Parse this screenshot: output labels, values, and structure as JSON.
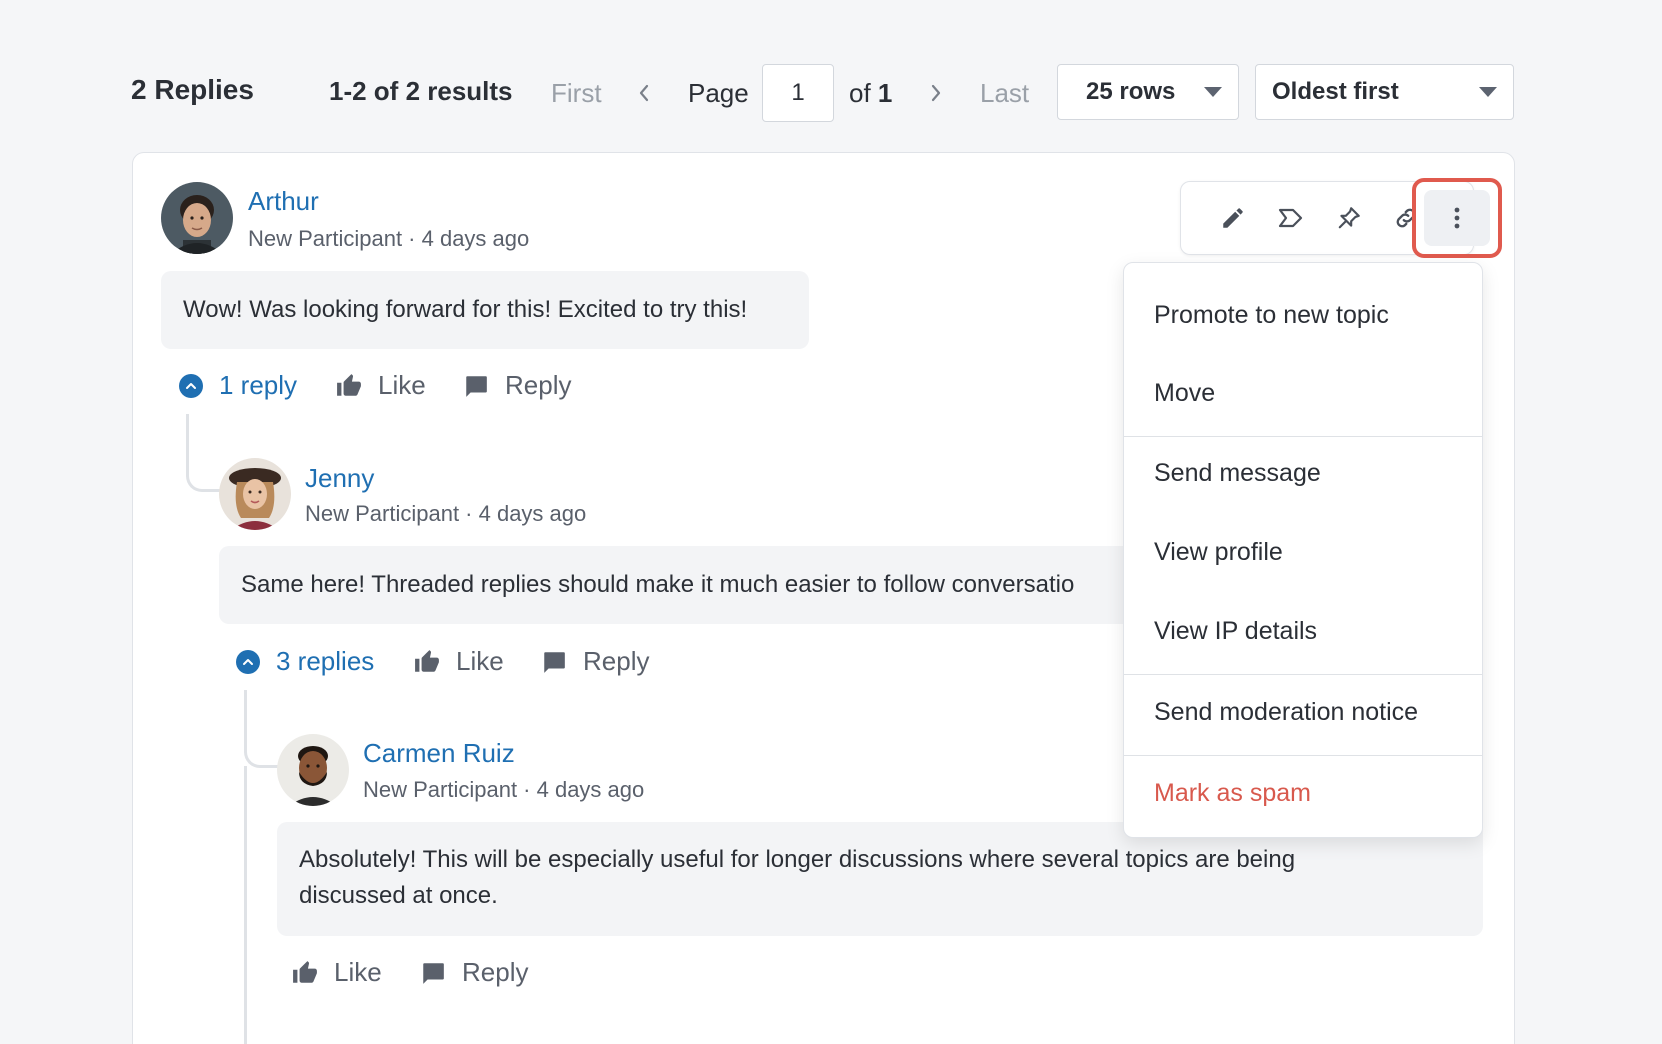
{
  "header": {
    "title": "2 Replies",
    "results": "1-2 of 2 results",
    "first_label": "First",
    "last_label": "Last",
    "page_label": "Page",
    "page_value": "1",
    "of_prefix": "of",
    "of_total": "1",
    "rows_select": "25 rows",
    "sort_select": "Oldest first"
  },
  "post_tools": {
    "icons": [
      "pencil-icon",
      "label-icon",
      "pin-icon",
      "link-icon",
      "more-vertical-icon"
    ]
  },
  "menu": {
    "items": [
      "Promote to new topic",
      "Move",
      "Send message",
      "View profile",
      "View IP details",
      "Send moderation notice",
      "Mark as spam"
    ],
    "danger_color": "#d8594d"
  },
  "posts": [
    {
      "author": "Arthur",
      "meta": "New Participant · 4 days ago",
      "body": "Wow! Was looking forward for this! Excited to try this!",
      "toggle": "1 reply",
      "like": "Like",
      "reply": "Reply"
    },
    {
      "author": "Jenny",
      "meta": "New Participant · 4 days ago",
      "body": "Same here! Threaded replies should make it much easier to follow conversatio",
      "toggle": "3 replies",
      "like": "Like",
      "reply": "Reply"
    },
    {
      "author": "Carmen Ruiz",
      "meta": "New Participant · 4 days ago",
      "body_line1": "Absolutely! This will be especially useful for longer discussions where several topics are being",
      "body_line2": "discussed at once.",
      "like": "Like",
      "reply": "Reply"
    }
  ],
  "colors": {
    "link": "#1f6fb2",
    "highlight": "#e05a4e",
    "background": "#f5f6f8"
  }
}
